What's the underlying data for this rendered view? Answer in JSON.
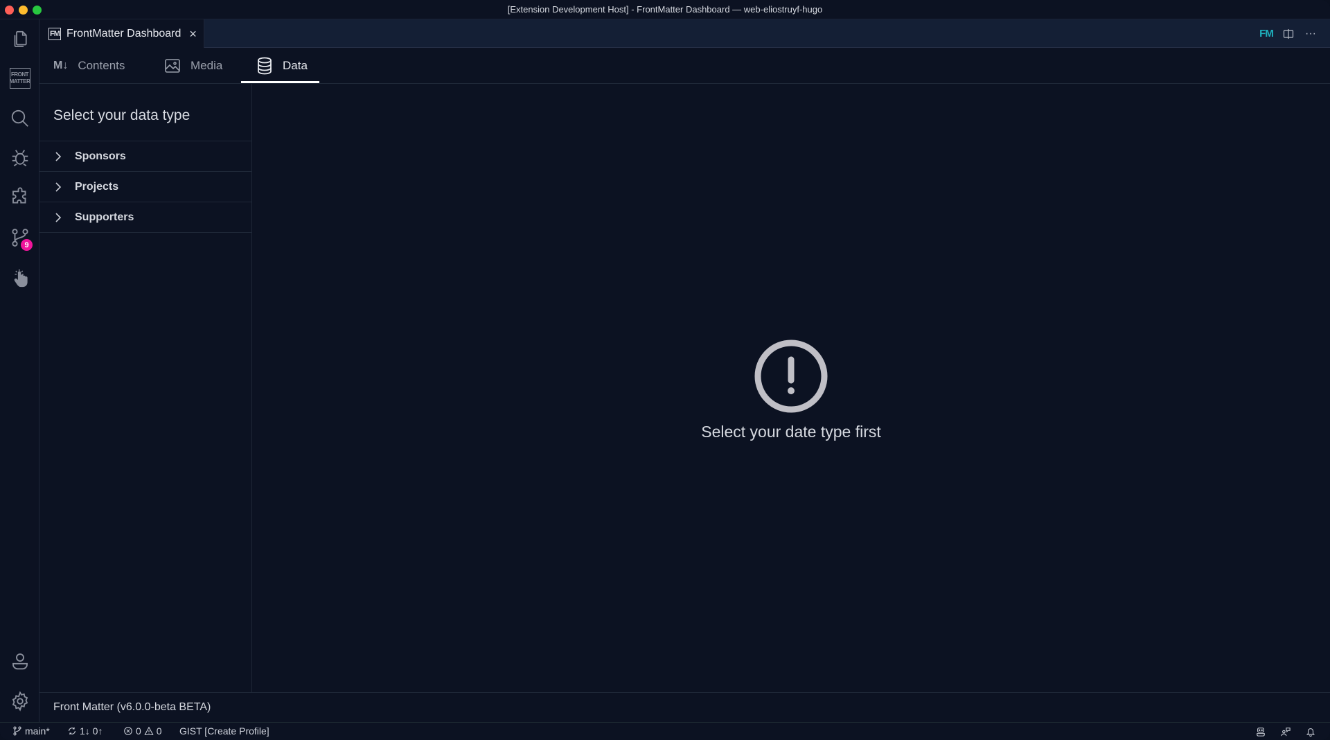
{
  "window": {
    "title": "[Extension Development Host] - FrontMatter Dashboard — web-eliostruyf-hugo"
  },
  "activity_bar": {
    "items": [
      {
        "name": "explorer",
        "icon": "files-icon"
      },
      {
        "name": "front-matter",
        "icon": "front-matter-logo-icon",
        "logo_line1": "FRONT",
        "logo_line2": "MATTER"
      },
      {
        "name": "search",
        "icon": "search-icon"
      },
      {
        "name": "run-and-debug",
        "icon": "bug-icon"
      },
      {
        "name": "extensions",
        "icon": "puzzle-icon"
      },
      {
        "name": "source-control",
        "icon": "source-control-icon",
        "badge": "9"
      },
      {
        "name": "touch",
        "icon": "pointer-hand-icon"
      }
    ],
    "bottom_items": [
      {
        "name": "accounts",
        "icon": "account-icon"
      },
      {
        "name": "manage",
        "icon": "gear-icon"
      }
    ],
    "badge_color": "#f0149b"
  },
  "editor_tab": {
    "logo": "FM",
    "label": "FrontMatter Dashboard",
    "close": "×"
  },
  "tab_actions": {
    "fm": "FM",
    "split": "split-editor-icon",
    "more": "···"
  },
  "dashboard_nav": {
    "tabs": [
      {
        "label": "Contents",
        "icon_text": "M↓",
        "active": false
      },
      {
        "label": "Media",
        "icon": "image-icon",
        "active": false
      },
      {
        "label": "Data",
        "icon": "database-icon",
        "active": true
      }
    ]
  },
  "data_sidebar": {
    "title": "Select your data type",
    "items": [
      {
        "label": "Sponsors"
      },
      {
        "label": "Projects"
      },
      {
        "label": "Supporters"
      }
    ]
  },
  "empty_state": {
    "icon": "exclamation-circle-icon",
    "message": "Select your date type first"
  },
  "footer": {
    "version": "Front Matter (v6.0.0-beta BETA)"
  },
  "status_bar": {
    "branch": "main*",
    "sync": "1↓ 0↑",
    "errors": "0",
    "warnings": "0",
    "gist": "GIST [Create Profile]",
    "right_icons": [
      "copilot-icon",
      "live-share-icon",
      "bell-icon"
    ]
  },
  "colors": {
    "background": "#0c1222",
    "tab_bar": "#141f35",
    "accent_fm": "#1fb0bd",
    "badge": "#f0149b"
  }
}
